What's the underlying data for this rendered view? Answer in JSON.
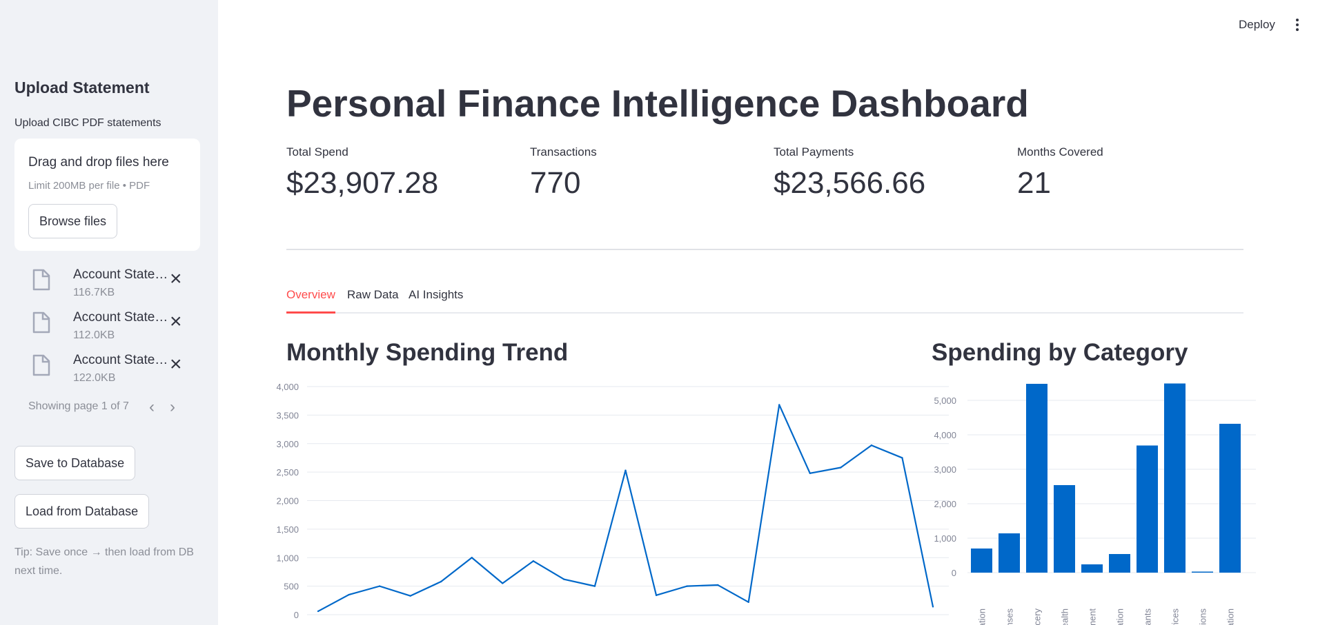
{
  "sidebar": {
    "title": "Upload Statement",
    "uploader_label": "Upload CIBC PDF statements",
    "dropzone_title": "Drag and drop files here",
    "dropzone_limit": "Limit 200MB per file • PDF",
    "browse_label": "Browse files",
    "files": [
      {
        "name": "Account Statement",
        "size": "116.7KB"
      },
      {
        "name": "Account Statement",
        "size": "112.0KB"
      },
      {
        "name": "Account Statement",
        "size": "122.0KB"
      }
    ],
    "pager_text": "Showing page 1 of 7",
    "save_label": "Save to Database",
    "load_label": "Load from Database",
    "tip": "Tip: Save once → then load from DB next time."
  },
  "header": {
    "deploy_label": "Deploy"
  },
  "main": {
    "title": "Personal Finance Intelligence Dashboard",
    "metrics": [
      {
        "label": "Total Spend",
        "value": "$23,907.28"
      },
      {
        "label": "Transactions",
        "value": "770"
      },
      {
        "label": "Total Payments",
        "value": "$23,566.66"
      },
      {
        "label": "Months Covered",
        "value": "21"
      }
    ],
    "tabs": [
      {
        "label": "Overview"
      },
      {
        "label": "Raw Data"
      },
      {
        "label": "AI Insights"
      }
    ],
    "active_tab": "Overview"
  },
  "colors": {
    "accent": "#ff4b4b",
    "series": "#0068c9",
    "sidebar_bg": "#f0f2f6"
  },
  "chart_data": [
    {
      "type": "line",
      "title": "Monthly Spending Trend",
      "xlabel": "",
      "ylabel": "",
      "ylim": [
        0,
        4000
      ],
      "yticks": [
        0,
        500,
        1000,
        1500,
        2000,
        2500,
        3000,
        3500,
        4000
      ],
      "ytick_labels": [
        "0",
        "500",
        "1,000",
        "1,500",
        "2,000",
        "2,500",
        "3,000",
        "3,500",
        "4,000"
      ],
      "values": [
        60,
        350,
        500,
        330,
        580,
        1000,
        550,
        940,
        620,
        500,
        2530,
        340,
        500,
        520,
        220,
        3680,
        2480,
        2580,
        2970,
        2750,
        140
      ],
      "grid": true
    },
    {
      "type": "bar",
      "title": "Spending by Category",
      "xlabel": "",
      "ylabel": "",
      "ylim": [
        0,
        5000
      ],
      "yticks": [
        0,
        1000,
        2000,
        3000,
        4000,
        5000
      ],
      "ytick_labels": [
        "0",
        "1,000",
        "2,000",
        "3,000",
        "4,000",
        "5,000"
      ],
      "categories": [
        "cation",
        "enses",
        "rocery",
        "Health",
        "ement",
        "eation",
        "urants",
        "rvices",
        "ctions",
        "dation"
      ],
      "values": [
        700,
        1140,
        5480,
        2540,
        240,
        540,
        3690,
        5490,
        30,
        4320
      ],
      "grid": true
    }
  ]
}
